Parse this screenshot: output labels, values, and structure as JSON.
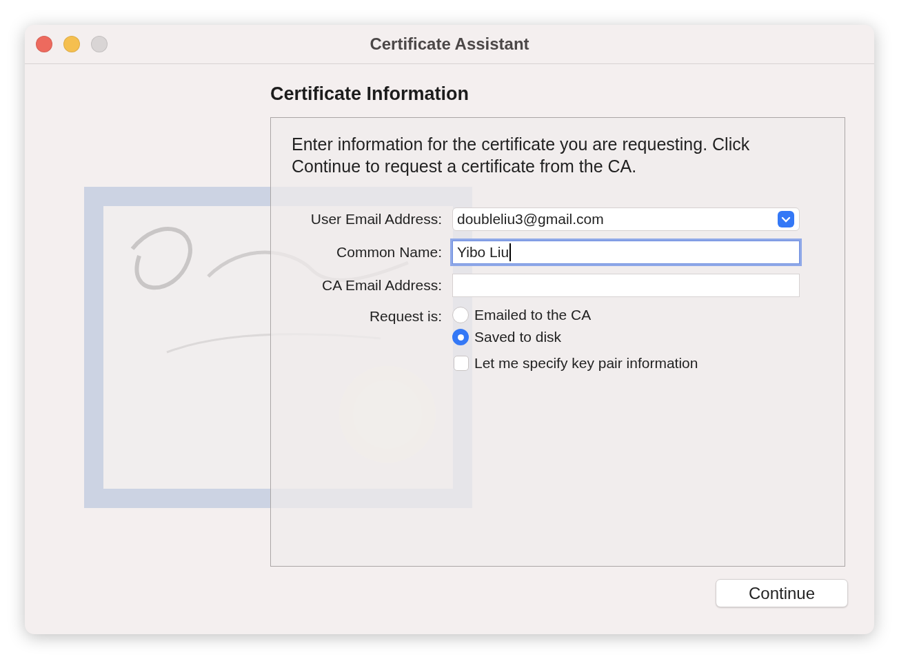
{
  "window": {
    "title": "Certificate Assistant",
    "traffic_lights": [
      {
        "color": "#ed6a5e"
      },
      {
        "color": "#f5bf4f"
      },
      {
        "color": "#d9d5d5"
      }
    ]
  },
  "heading": "Certificate Information",
  "description": "Enter information for the certificate you are requesting. Click Continue to request a certificate from the CA.",
  "fields": [
    {
      "kind": "popup",
      "label": "User Email Address:",
      "value": "doubleliu3@gmail.com",
      "focused": false
    },
    {
      "kind": "text",
      "label": "Common Name:",
      "value": "Yibo Liu",
      "focused": true
    },
    {
      "kind": "text",
      "label": "CA Email Address:",
      "focused": false
    }
  ],
  "request": {
    "label": "Request is:",
    "options": [
      {
        "label": "Emailed to the CA",
        "selected": false
      },
      {
        "label": "Saved to disk",
        "selected": true
      }
    ]
  },
  "checkbox": {
    "label": "Let me specify key pair information",
    "checked": false
  },
  "buttons": [
    {
      "label": "Continue"
    }
  ]
}
